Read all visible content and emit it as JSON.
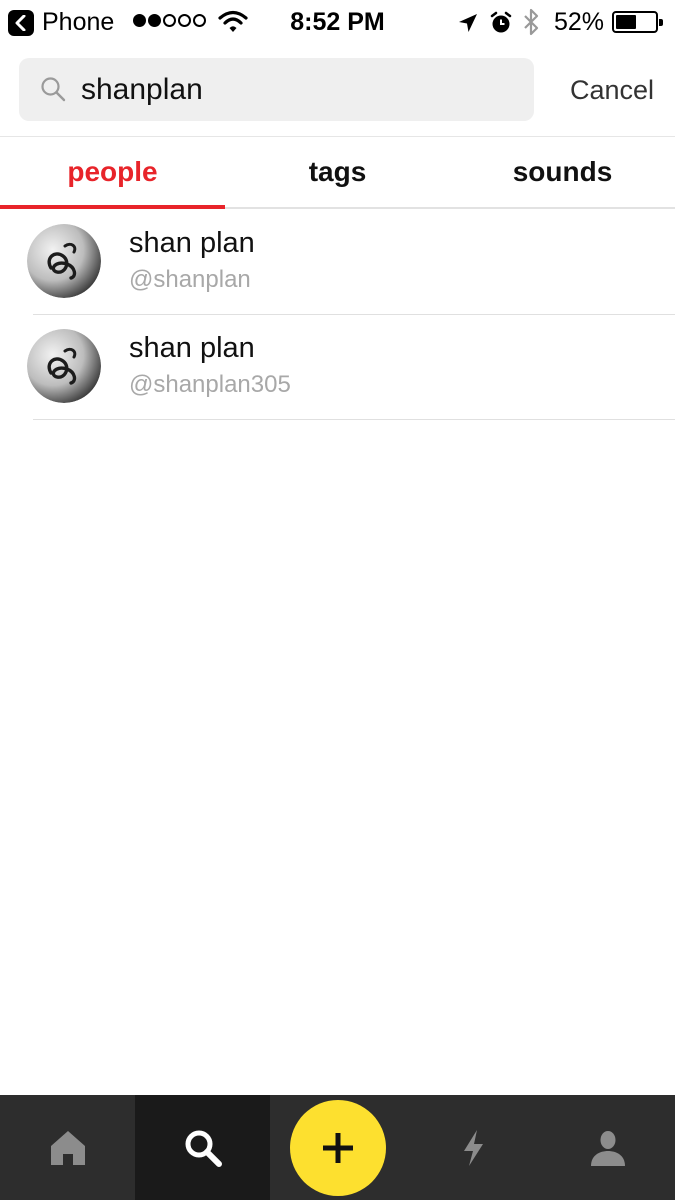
{
  "status_bar": {
    "carrier": "Phone",
    "time": "8:52 PM",
    "battery_percent": "52%",
    "battery_level": 0.52,
    "signal_bars_filled": 2,
    "signal_bars_total": 5,
    "icons": [
      "back-to-app-icon",
      "wifi-icon",
      "location-icon",
      "alarm-icon",
      "bluetooth-icon",
      "battery-icon"
    ]
  },
  "search": {
    "value": "shanplan",
    "cancel_label": "Cancel"
  },
  "tabs": [
    {
      "label": "people",
      "active": true
    },
    {
      "label": "tags",
      "active": false
    },
    {
      "label": "sounds",
      "active": false
    }
  ],
  "results": [
    {
      "display_name": "shan plan",
      "username": "@shanplan"
    },
    {
      "display_name": "shan plan",
      "username": "@shanplan305"
    }
  ],
  "bottom_nav": {
    "items": [
      "home-icon",
      "search-icon",
      "create-plus-icon",
      "activity-bolt-icon",
      "profile-icon"
    ],
    "active": "search-icon"
  },
  "colors": {
    "accent_red": "#e8242a",
    "create_yellow": "#fde02f",
    "nav_background": "#2d2d2d",
    "nav_active_background": "#1a1a1a",
    "search_background": "#efefef",
    "muted_text": "#a8a8a8"
  }
}
